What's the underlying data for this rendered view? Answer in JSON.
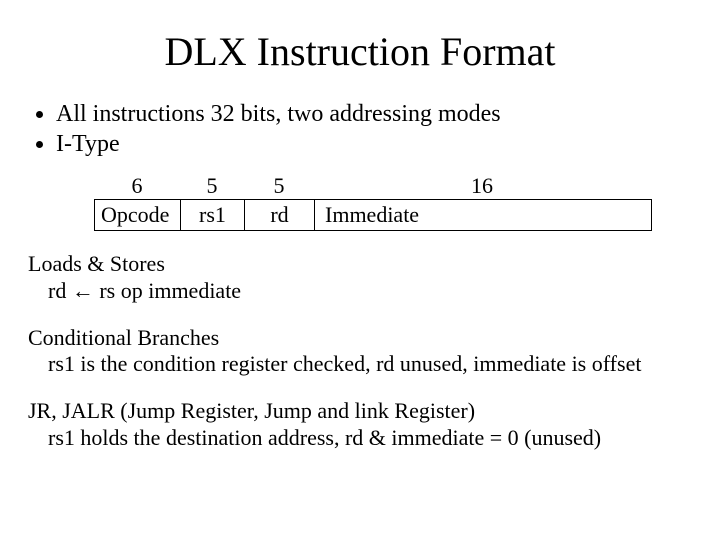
{
  "title": "DLX Instruction Format",
  "bullets": {
    "b1": "All instructions 32 bits, two addressing modes",
    "b2": "I-Type"
  },
  "format": {
    "bits": {
      "opcode": "6",
      "rs1": "5",
      "rd": "5",
      "imm": "16"
    },
    "labels": {
      "opcode": "Opcode",
      "rs1": "rs1",
      "rd": "rd",
      "imm": "Immediate"
    }
  },
  "sections": {
    "loads": {
      "head": "Loads & Stores",
      "body_prefix": "rd ",
      "arrow": "←",
      "body_suffix": " rs  op  immediate"
    },
    "branches": {
      "head": "Conditional Branches",
      "body": "rs1 is the condition register checked, rd unused, immediate is offset"
    },
    "jumps": {
      "head": "JR, JALR  (Jump Register, Jump and link Register)",
      "body": "rs1 holds the destination address, rd & immediate = 0 (unused)"
    }
  }
}
